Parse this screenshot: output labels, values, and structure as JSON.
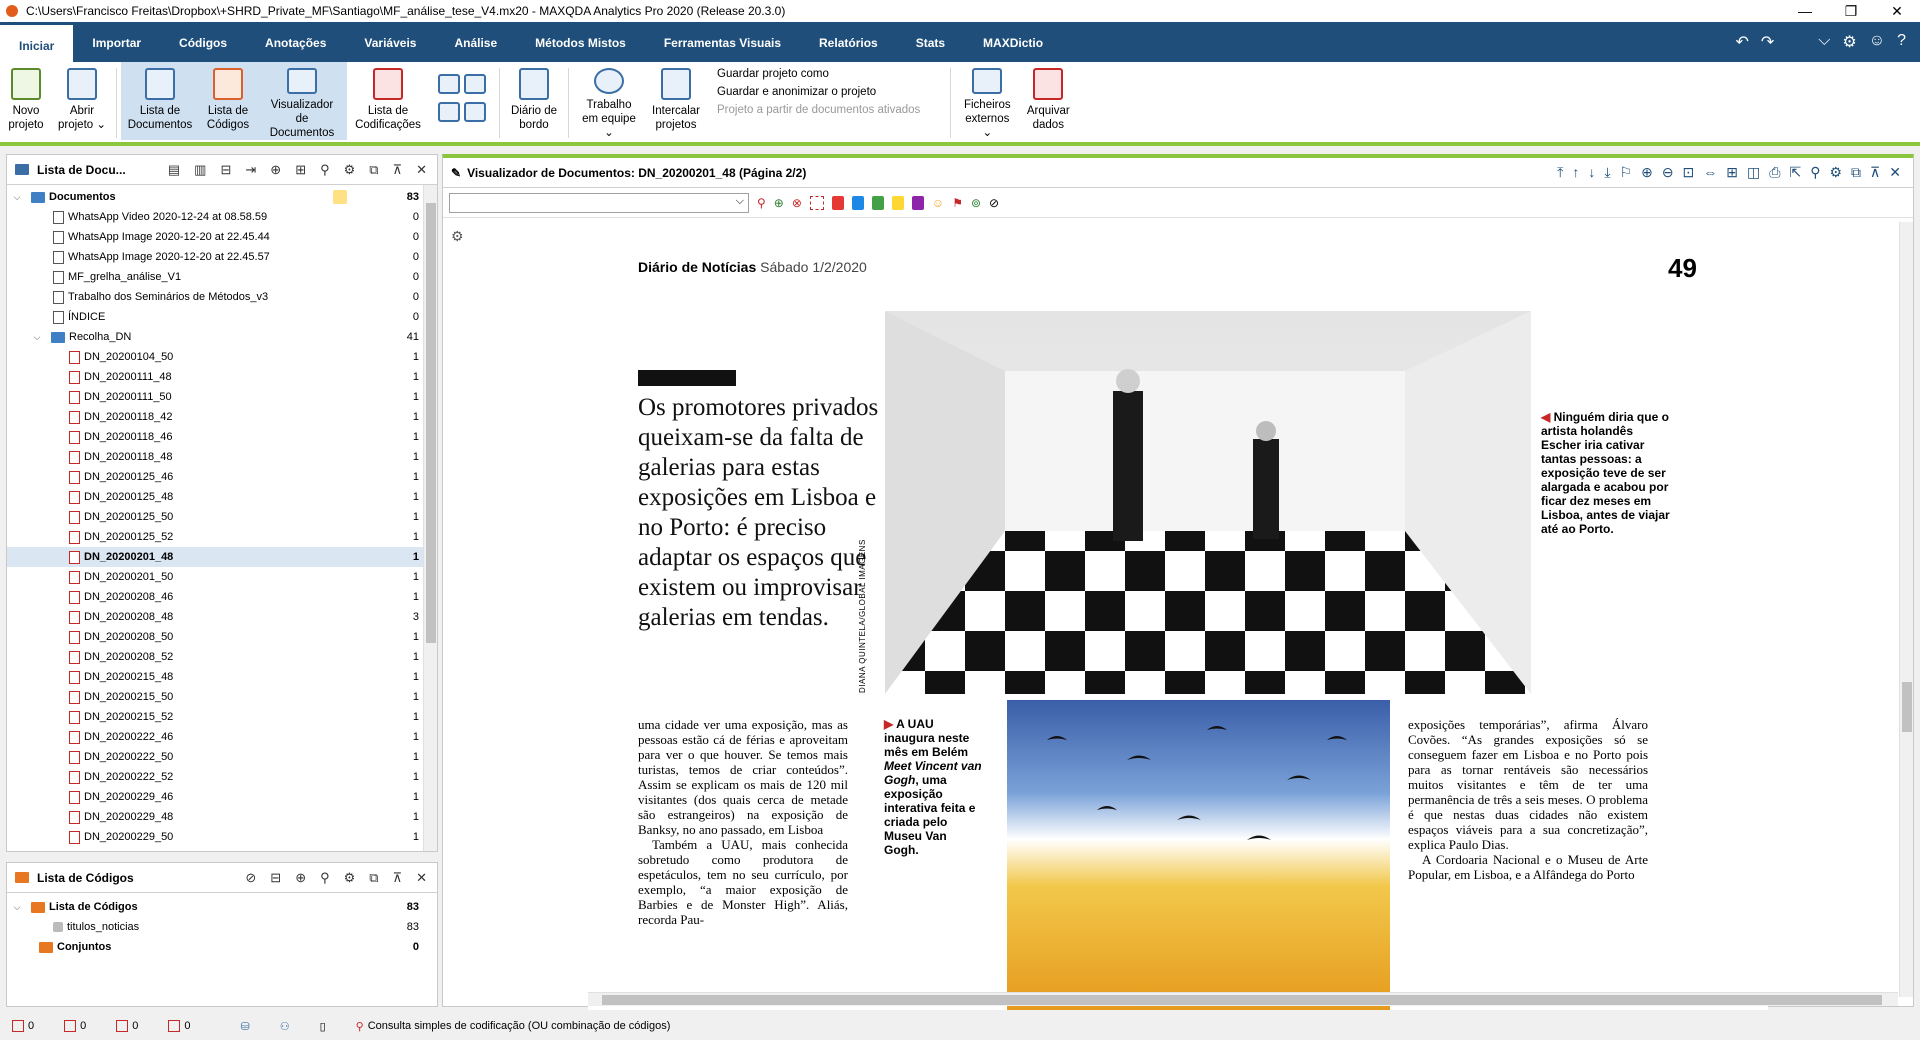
{
  "window": {
    "title": "C:\\Users\\Francisco Freitas\\Dropbox\\+SHRD_Private_MF\\Santiago\\MF_análise_tese_V4.mx20 - MAXQDA Analytics Pro 2020 (Release 20.3.0)",
    "minimize": "—",
    "maximize": "❐",
    "close": "✕"
  },
  "menu": [
    "Iniciar",
    "Importar",
    "Códigos",
    "Anotações",
    "Variáveis",
    "Análise",
    "Métodos Mistos",
    "Ferramentas Visuais",
    "Relatórios",
    "Stats",
    "MAXDictio"
  ],
  "menu_icons": {
    "undo": "↶",
    "redo": "↷",
    "expand": "⌵",
    "settings": "⚙",
    "smiley": "☺",
    "help": "?"
  },
  "ribbon": {
    "new_project": "Novo projeto",
    "open_project": "Abrir projeto ⌄",
    "doc_list": "Lista de Documentos",
    "code_list": "Lista de Códigos",
    "doc_viewer": "Visualizador de Documentos",
    "coding_list": "Lista de Codificações",
    "logbook": "Diário de bordo",
    "teamwork": "Trabalho em equipe ⌄",
    "merge_projects": "Intercalar projetos",
    "save_as": "Guardar projeto como",
    "save_anon": "Guardar e anonimizar o projeto",
    "project_from_docs": "Projeto a partir de documentos ativados",
    "external_files": "Ficheiros externos ⌄",
    "archive_data": "Arquivar dados"
  },
  "doc_panel": {
    "title": "Lista de Docu...",
    "root": {
      "label": "Documentos",
      "count": "83"
    },
    "items": [
      {
        "label": "WhatsApp Video 2020-12-24 at 08.58.59",
        "count": "0",
        "type": "doc"
      },
      {
        "label": "WhatsApp Image 2020-12-20 at 22.45.44",
        "count": "0",
        "type": "doc"
      },
      {
        "label": "WhatsApp Image 2020-12-20 at 22.45.57",
        "count": "0",
        "type": "doc"
      },
      {
        "label": "MF_grelha_análise_V1",
        "count": "0",
        "type": "doc"
      },
      {
        "label": "Trabalho dos Seminários de Métodos_v3",
        "count": "0",
        "type": "doc"
      },
      {
        "label": "ÍNDICE",
        "count": "0",
        "type": "doc"
      }
    ],
    "group": {
      "label": "Recolha_DN",
      "count": "41"
    },
    "group_items": [
      {
        "label": "DN_20200104_50",
        "count": "1"
      },
      {
        "label": "DN_20200111_48",
        "count": "1"
      },
      {
        "label": "DN_20200111_50",
        "count": "1"
      },
      {
        "label": "DN_20200118_42",
        "count": "1"
      },
      {
        "label": "DN_20200118_46",
        "count": "1"
      },
      {
        "label": "DN_20200118_48",
        "count": "1"
      },
      {
        "label": "DN_20200125_46",
        "count": "1"
      },
      {
        "label": "DN_20200125_48",
        "count": "1"
      },
      {
        "label": "DN_20200125_50",
        "count": "1"
      },
      {
        "label": "DN_20200125_52",
        "count": "1"
      },
      {
        "label": "DN_20200201_48",
        "count": "1",
        "selected": true
      },
      {
        "label": "DN_20200201_50",
        "count": "1"
      },
      {
        "label": "DN_20200208_46",
        "count": "1"
      },
      {
        "label": "DN_20200208_48",
        "count": "3"
      },
      {
        "label": "DN_20200208_50",
        "count": "1"
      },
      {
        "label": "DN_20200208_52",
        "count": "1"
      },
      {
        "label": "DN_20200215_48",
        "count": "1"
      },
      {
        "label": "DN_20200215_50",
        "count": "1"
      },
      {
        "label": "DN_20200215_52",
        "count": "1"
      },
      {
        "label": "DN_20200222_46",
        "count": "1"
      },
      {
        "label": "DN_20200222_50",
        "count": "1"
      },
      {
        "label": "DN_20200222_52",
        "count": "1"
      },
      {
        "label": "DN_20200229_46",
        "count": "1"
      },
      {
        "label": "DN_20200229_48",
        "count": "1"
      },
      {
        "label": "DN_20200229_50",
        "count": "1"
      }
    ]
  },
  "code_panel": {
    "title": "Lista de Códigos",
    "root": {
      "label": "Lista de Códigos",
      "count": "83"
    },
    "child": {
      "label": "titulos_noticias",
      "count": "83"
    },
    "sets": {
      "label": "Conjuntos",
      "count": "0"
    }
  },
  "viewer": {
    "title": "Visualizador de Documentos: DN_20200201_48  (Página 2/2)"
  },
  "newspaper": {
    "masthead": "Diário de Notícias",
    "date": "Sábado 1/2/2020",
    "page": "49",
    "headline": "Os promotores privados queixam-se da falta de galerias para estas exposições em Lisboa e no Porto: é preciso adaptar os espaços que existem ou improvisar galerias em tendas.",
    "photo_credit": "DIANA QUINTELA/GLOBAL IMAGENS",
    "caption1_lead": "◀ ",
    "caption1": "Ninguém diria que o artista holandês Escher iria cativar tantas pessoas: a exposição teve de ser alargada e acabou por ficar dez meses em Lisboa, antes de viajar até ao Porto.",
    "caption2_lead": "▶ ",
    "caption2_a": "A UAU inaugura neste mês em Belém ",
    "caption2_em": "Meet Vincent van Gogh",
    "caption2_b": ", uma exposição interativa feita e criada pelo Museu Van Gogh.",
    "col1_p1": "uma cidade ver uma exposição, mas as pessoas estão cá de férias e aproveitam para ver o que houver. Se temos mais turistas, temos de criar conteúdos”. Assim se explicam os mais de 120 mil visitantes (dos quais cerca de metade são estrangeiros) na exposição de Banksy, no ano passado, em Lisboa",
    "col1_p2": "Também a UAU, mais conhecida sobretudo como produtora de espetáculos, tem no seu currículo, por exemplo, “a maior exposição de Barbies e de Monster High”. Aliás, recorda Pau-",
    "col3_p1": "exposições temporárias”, afirma Álvaro Covões. “As grandes exposições só se conseguem fazer em Lisboa e no Porto pois para as tornar rentáveis são necessários muitos visitantes e têm de ter uma permanência de três a seis meses. O problema é que nestas duas cidades não existem espaços viáveis para a sua concretização”, explica Paulo Dias.",
    "col3_p2": "A Cordoaria Nacional e o Museu de Arte Popular, em Lisboa, e a Alfândega do Porto"
  },
  "status": {
    "s1": "0",
    "s2": "0",
    "s3": "0",
    "s4": "0",
    "query": "Consulta simples de codificação (OU combinação de códigos)"
  },
  "colors": {
    "menubar": "#1e4e79",
    "accent_green": "#8cc63f",
    "selection": "#dbe6f3"
  }
}
